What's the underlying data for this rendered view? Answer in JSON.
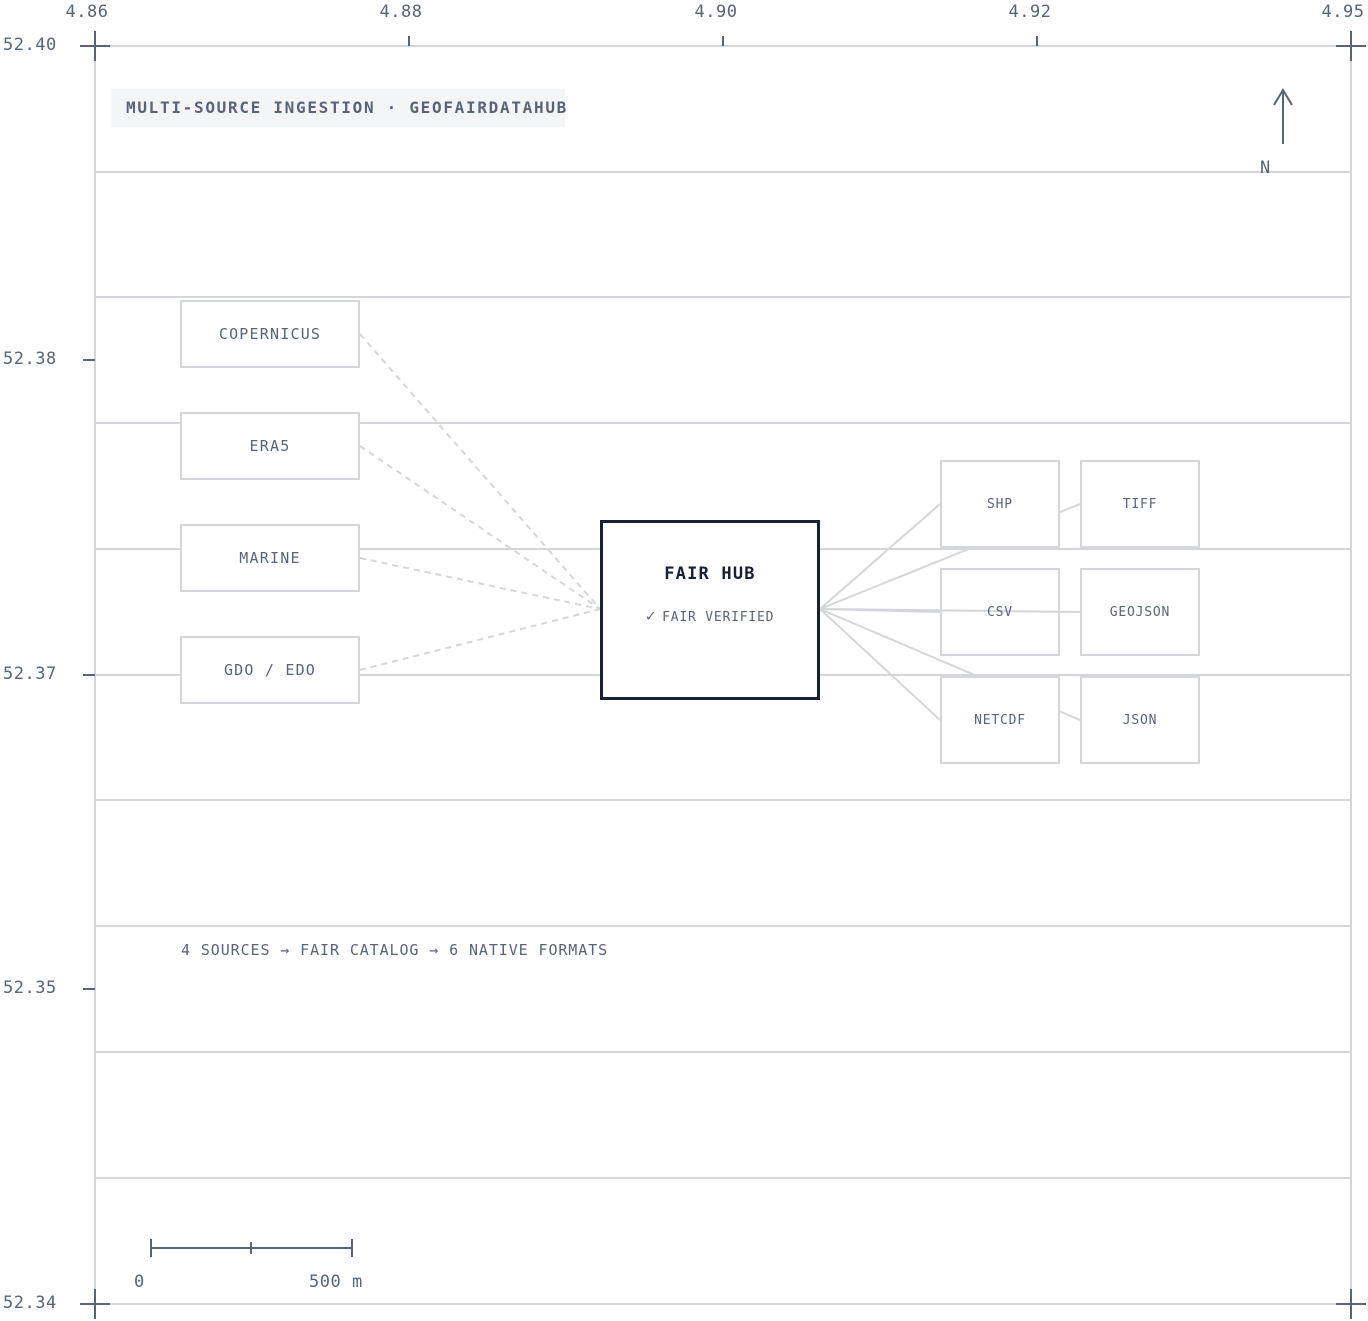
{
  "map": {
    "title": "MULTI-SOURCE INGESTION · GEOFAIRDATAHUB",
    "lon_ticks": [
      "4.86",
      "4.88",
      "4.90",
      "4.92",
      "4.95"
    ],
    "lat_ticks": [
      "52.40",
      "52.38",
      "52.37",
      "52.35",
      "52.34"
    ],
    "north_label": "N",
    "scale": {
      "start_label": "0",
      "end_label": "500 m"
    },
    "footnote": "4 SOURCES → FAIR CATALOG → 6 NATIVE FORMATS"
  },
  "sources": [
    "COPERNICUS",
    "ERA5",
    "MARINE",
    "GDO / EDO"
  ],
  "hub": {
    "title": "FAIR HUB",
    "status_icon": "check-icon",
    "status": "FAIR VERIFIED"
  },
  "formats": [
    "SHP",
    "TIFF",
    "CSV",
    "GEOJSON",
    "NETCDF",
    "JSON"
  ],
  "colors": {
    "frame": "#d4d6da",
    "tick": "#5a6478",
    "hub_border": "#1a2033",
    "text": "#5a6478",
    "title_bg": "#f4f5f7"
  }
}
